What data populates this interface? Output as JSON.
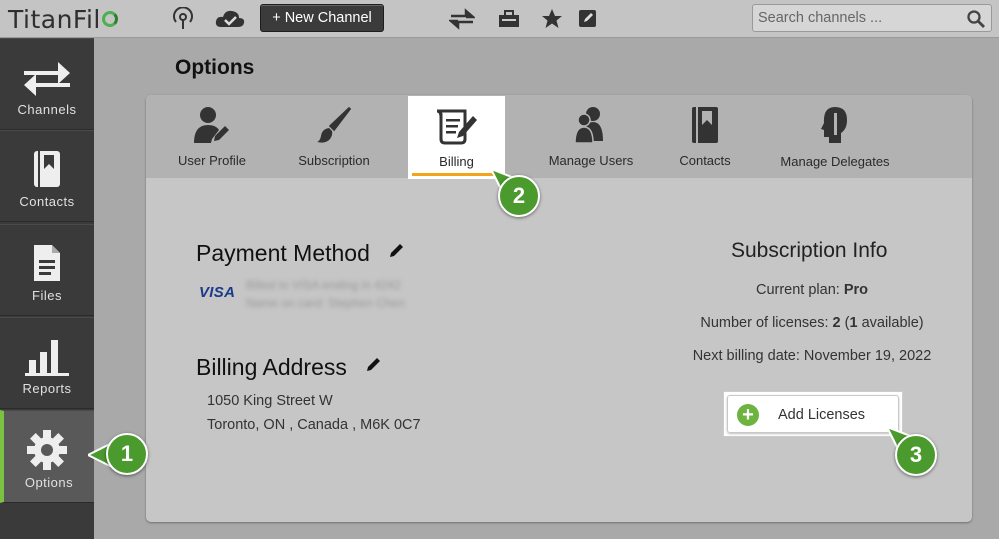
{
  "app": {
    "logo_text": "TitanFil",
    "logo_mark": "refresh-circle-icon",
    "brand_color": "#4caf50"
  },
  "topbar": {
    "new_channel_label": "+ New Channel",
    "search_placeholder": "Search channels ...",
    "icons": [
      "broadcast-icon",
      "cloud-check-icon",
      "transfer-arrows-icon",
      "toolbox-icon",
      "star-icon",
      "edit-note-icon",
      "search-icon"
    ]
  },
  "sidebar": {
    "items": [
      {
        "label": "Channels",
        "icon": "arrows-exchange-icon"
      },
      {
        "label": "Contacts",
        "icon": "address-book-icon"
      },
      {
        "label": "Files",
        "icon": "file-icon"
      },
      {
        "label": "Reports",
        "icon": "bar-chart-icon"
      },
      {
        "label": "Options",
        "icon": "gear-icon",
        "active": true
      }
    ],
    "active_color": "#7cc242"
  },
  "page": {
    "title": "Options"
  },
  "tabs": [
    {
      "label": "User Profile",
      "icon": "user-edit-icon"
    },
    {
      "label": "Subscription",
      "icon": "brush-icon"
    },
    {
      "label": "Billing",
      "icon": "scroll-pen-icon",
      "active": true
    },
    {
      "label": "Manage Users",
      "icon": "users-icon"
    },
    {
      "label": "Contacts",
      "icon": "contact-book-icon"
    },
    {
      "label": "Manage Delegates",
      "icon": "delegate-profile-icon"
    }
  ],
  "billing": {
    "payment_title": "Payment Method",
    "card_brand": "VISA",
    "card_line1": "Billed to VISA ending in 4242",
    "card_line2": "Name on card: Stephen Chen",
    "address_title": "Billing Address",
    "address_line1": "1050 King Street W",
    "address_line2": "Toronto, ON , Canada , M6K 0C7"
  },
  "subscription": {
    "title": "Subscription Info",
    "plan_label": "Current plan: ",
    "plan_value": "Pro",
    "licenses_label": "Number of licenses: ",
    "licenses_count": "2",
    "licenses_open": " (",
    "licenses_available": "1",
    "licenses_suffix": " available)",
    "next_billing": "Next billing date: November 19, 2022",
    "add_button": "Add Licenses"
  },
  "callouts": [
    "1",
    "2",
    "3"
  ],
  "colors": {
    "callout": "#4a9a2d",
    "active_tab_underline": "#f2a51a"
  }
}
